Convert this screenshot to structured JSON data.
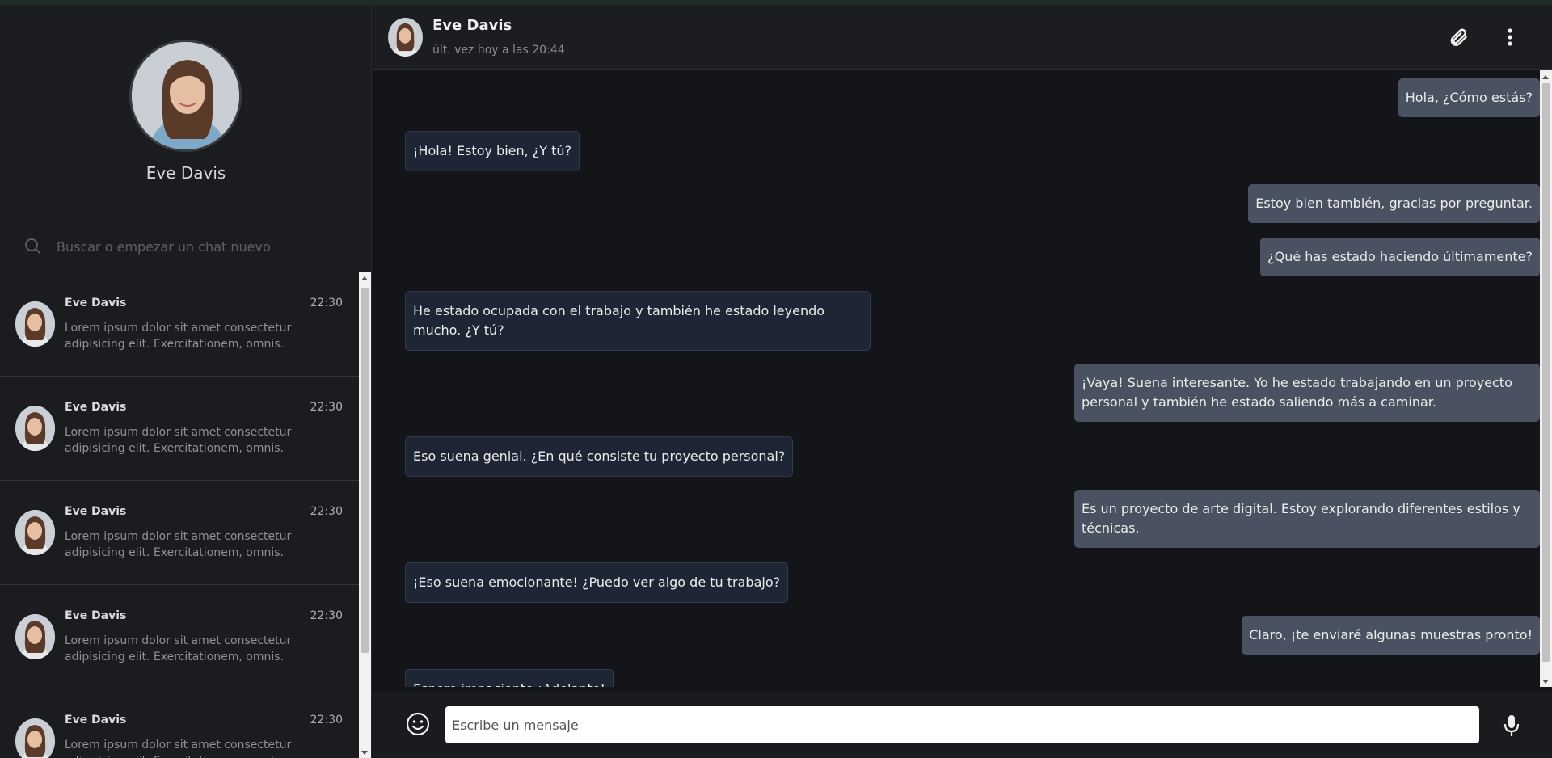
{
  "profile": {
    "name": "Eve Davis"
  },
  "search": {
    "placeholder": "Buscar o empezar un chat nuevo"
  },
  "chat_list": [
    {
      "name": "Eve Davis",
      "time": "22:30",
      "preview": "Lorem ipsum dolor sit amet consectetur adipisicing elit. Exercitationem, omnis."
    },
    {
      "name": "Eve Davis",
      "time": "22:30",
      "preview": "Lorem ipsum dolor sit amet consectetur adipisicing elit. Exercitationem, omnis."
    },
    {
      "name": "Eve Davis",
      "time": "22:30",
      "preview": "Lorem ipsum dolor sit amet consectetur adipisicing elit. Exercitationem, omnis."
    },
    {
      "name": "Eve Davis",
      "time": "22:30",
      "preview": "Lorem ipsum dolor sit amet consectetur adipisicing elit. Exercitationem, omnis."
    },
    {
      "name": "Eve Davis",
      "time": "22:30",
      "preview": "Lorem ipsum dolor sit amet consectetur adipisicing elit. Exercitationem, omnis."
    }
  ],
  "header": {
    "name": "Eve Davis",
    "status": "últ. vez hoy a las 20:44",
    "attach_icon": "paperclip-icon",
    "menu_icon": "more-vertical-icon"
  },
  "messages": [
    {
      "direction": "out",
      "text": "Hola, ¿Cómo estás?"
    },
    {
      "direction": "in",
      "text": "¡Hola! Estoy bien, ¿Y tú?"
    },
    {
      "direction": "out",
      "text": "Estoy bien también, gracias por preguntar."
    },
    {
      "direction": "out",
      "text": "¿Qué has estado haciendo últimamente?"
    },
    {
      "direction": "in",
      "text": "He estado ocupada con el trabajo y también he estado leyendo mucho. ¿Y tú?"
    },
    {
      "direction": "out",
      "text": "¡Vaya! Suena interesante. Yo he estado trabajando en un proyecto personal y también he estado saliendo más a caminar."
    },
    {
      "direction": "in",
      "text": "Eso suena genial. ¿En qué consiste tu proyecto personal?"
    },
    {
      "direction": "out",
      "text": "Es un proyecto de arte digital. Estoy explorando diferentes estilos y técnicas."
    },
    {
      "direction": "in",
      "text": "¡Eso suena emocionante! ¿Puedo ver algo de tu trabajo?"
    },
    {
      "direction": "out",
      "text": "Claro, ¡te enviaré algunas muestras pronto!"
    },
    {
      "direction": "in",
      "text": "Espero impaciente ¡Adelante!"
    }
  ],
  "composer": {
    "placeholder": "Escribe un mensaje",
    "emoji_icon": "smiley-icon",
    "mic_icon": "microphone-icon"
  },
  "colors": {
    "incoming_bubble": "#1e2535",
    "outgoing_bubble": "#4a5160",
    "background": "#141518"
  }
}
